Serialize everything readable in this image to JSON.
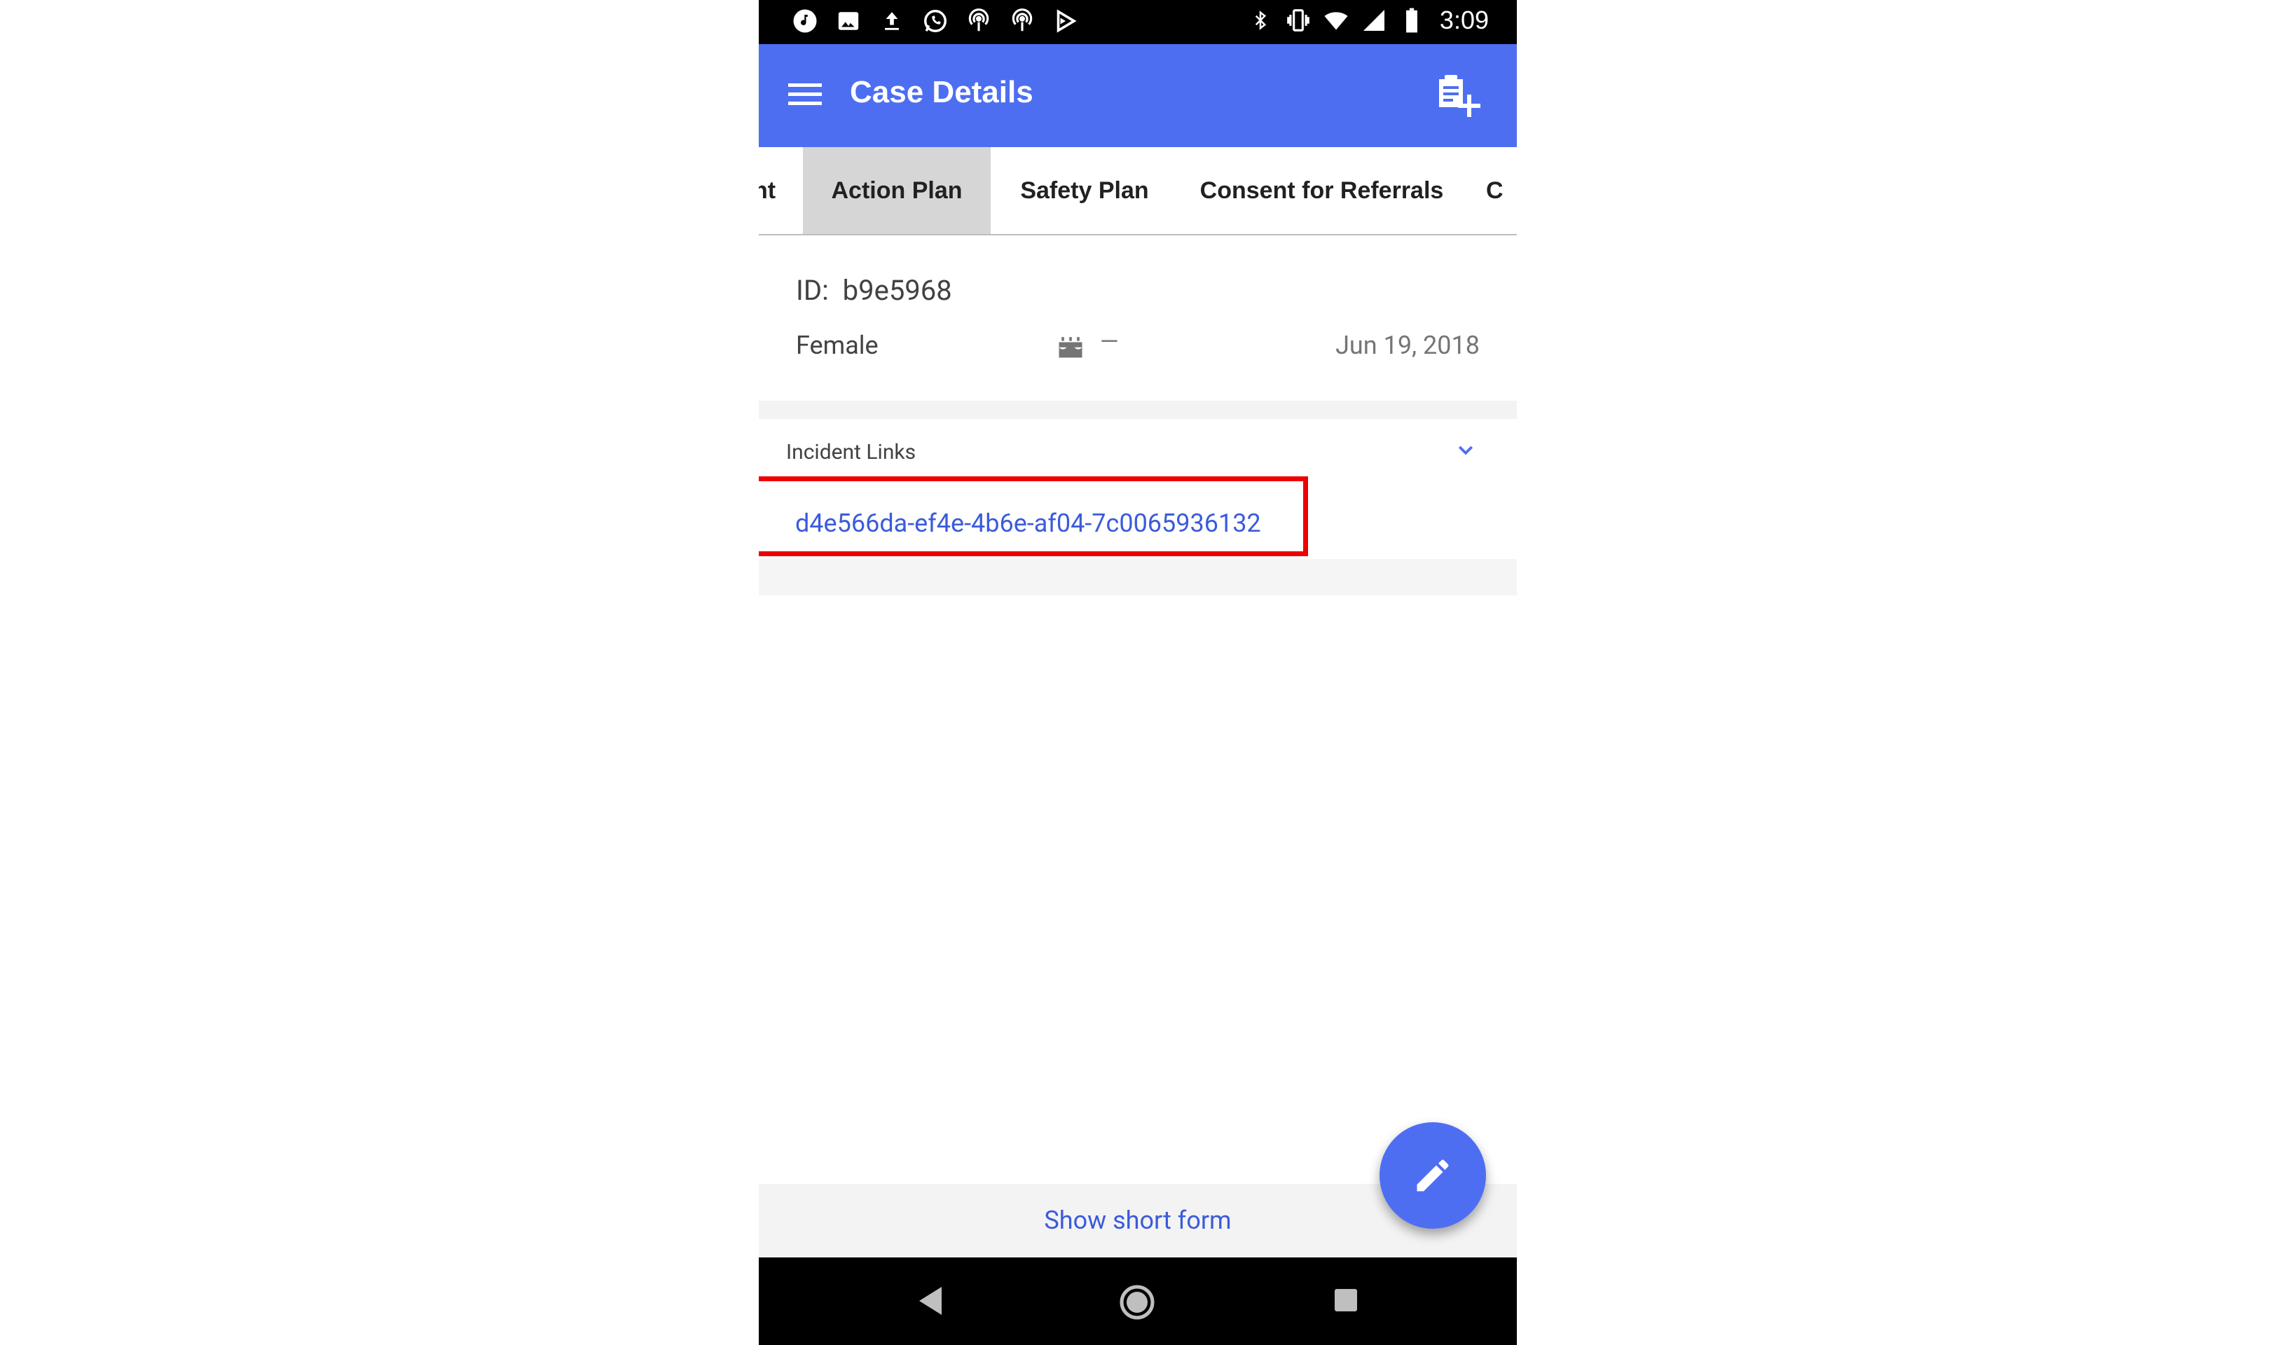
{
  "status_bar": {
    "time": "3:09",
    "left_icons": [
      "music-note-icon",
      "image-icon",
      "upload-icon",
      "whatsapp-icon",
      "podcast-icon",
      "podcast-icon",
      "play-store-icon"
    ],
    "right_icons": [
      "bluetooth-icon",
      "vibrate-icon",
      "wifi-icon",
      "signal-icon",
      "battery-icon"
    ]
  },
  "app_bar": {
    "title": "Case Details",
    "color": "#4e6ef2"
  },
  "tabs": [
    {
      "label": "nt",
      "active": false
    },
    {
      "label": "Action Plan",
      "active": true
    },
    {
      "label": "Safety Plan",
      "active": false
    },
    {
      "label": "Consent for Referrals",
      "active": false
    },
    {
      "label": "C",
      "active": false
    }
  ],
  "case": {
    "id_label": "ID:",
    "id_value": "b9e5968",
    "gender": "Female",
    "birthday": "—",
    "date": "Jun 19, 2018"
  },
  "incident_links": {
    "label": "Incident Links",
    "links": [
      "d4e566da-ef4e-4b6e-af04-7c0065936132"
    ]
  },
  "footer": {
    "show_short_form": "Show short form"
  },
  "colors": {
    "accent": "#4e6ef2",
    "link": "#3b5bdb",
    "highlight": "#ee0000"
  }
}
